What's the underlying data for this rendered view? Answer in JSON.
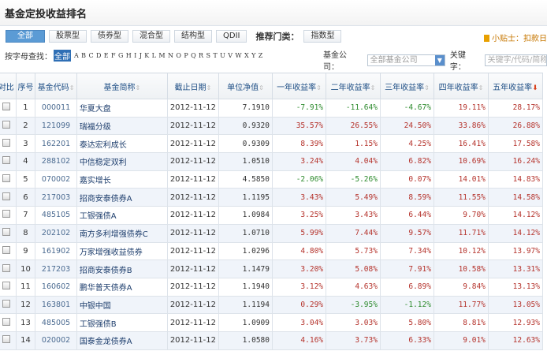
{
  "title": "基金定投收益排名",
  "tabs": [
    "全部",
    "股票型",
    "债券型",
    "混合型",
    "结构型",
    "QDII"
  ],
  "recommend_label": "推荐门类：",
  "recommend_tab": "指数型",
  "tip": "小贴士：扣款日",
  "letter_search": {
    "label": "按字母查找：",
    "all": "全部",
    "letters": [
      "A",
      "B",
      "C",
      "D",
      "E",
      "F",
      "G",
      "H",
      "I",
      "J",
      "K",
      "L",
      "M",
      "N",
      "O",
      "P",
      "Q",
      "R",
      "S",
      "T",
      "U",
      "V",
      "W",
      "X",
      "Y",
      "Z"
    ]
  },
  "company": {
    "label": "基金公司：",
    "value": "全部基金公司"
  },
  "keyword": {
    "label": "关键字：",
    "placeholder": "关键字/代码/简称"
  },
  "colors": {
    "positive": "#b5332c",
    "negative": "#2e8b2e",
    "active_tab": "#5b9bd5"
  },
  "table": {
    "headers": [
      "对比",
      "序号",
      "基金代码",
      "基金简称",
      "截止日期",
      "单位净值",
      "一年收益率",
      "二年收益率",
      "三年收益率",
      "四年收益率",
      "五年收益率"
    ],
    "sorted_column": "五年收益率",
    "rows": [
      [
        "1",
        "000011",
        "华夏大盘",
        "2012-11-12",
        "7.1910",
        "-7.91%",
        "-11.64%",
        "-4.67%",
        "19.11%",
        "28.17%"
      ],
      [
        "2",
        "121099",
        "瑞福分级",
        "2012-11-12",
        "0.9320",
        "35.57%",
        "26.55%",
        "24.50%",
        "33.86%",
        "26.88%"
      ],
      [
        "3",
        "162201",
        "泰达宏利成长",
        "2012-11-12",
        "0.9309",
        "8.39%",
        "1.15%",
        "4.25%",
        "16.41%",
        "17.58%"
      ],
      [
        "4",
        "288102",
        "中信稳定双利",
        "2012-11-12",
        "1.0510",
        "3.24%",
        "4.04%",
        "6.82%",
        "10.69%",
        "16.24%"
      ],
      [
        "5",
        "070002",
        "嘉实增长",
        "2012-11-12",
        "4.5850",
        "-2.06%",
        "-5.26%",
        "0.07%",
        "14.01%",
        "14.83%"
      ],
      [
        "6",
        "217003",
        "招商安泰债券A",
        "2012-11-12",
        "1.1195",
        "3.43%",
        "5.49%",
        "8.59%",
        "11.55%",
        "14.58%"
      ],
      [
        "7",
        "485105",
        "工银强债A",
        "2012-11-12",
        "1.0984",
        "3.25%",
        "3.43%",
        "6.44%",
        "9.70%",
        "14.12%"
      ],
      [
        "8",
        "202102",
        "南方多利增强债券C",
        "2012-11-12",
        "1.0710",
        "5.99%",
        "7.44%",
        "9.57%",
        "11.71%",
        "14.12%"
      ],
      [
        "9",
        "161902",
        "万家增强收益债券",
        "2012-11-12",
        "1.0296",
        "4.80%",
        "5.73%",
        "7.34%",
        "10.12%",
        "13.97%"
      ],
      [
        "10",
        "217203",
        "招商安泰债券B",
        "2012-11-12",
        "1.1479",
        "3.20%",
        "5.08%",
        "7.91%",
        "10.58%",
        "13.31%"
      ],
      [
        "11",
        "160602",
        "鹏华普天债券A",
        "2012-11-12",
        "1.1940",
        "3.12%",
        "4.63%",
        "6.89%",
        "9.84%",
        "13.13%"
      ],
      [
        "12",
        "163801",
        "中银中国",
        "2012-11-12",
        "1.1194",
        "0.29%",
        "-3.95%",
        "-1.12%",
        "11.77%",
        "13.05%"
      ],
      [
        "13",
        "485005",
        "工银强债B",
        "2012-11-12",
        "1.0909",
        "3.04%",
        "3.03%",
        "5.80%",
        "8.81%",
        "12.93%"
      ],
      [
        "14",
        "020002",
        "国泰金龙债券A",
        "2012-11-12",
        "1.0580",
        "4.16%",
        "3.73%",
        "6.33%",
        "9.01%",
        "12.63%"
      ]
    ]
  }
}
